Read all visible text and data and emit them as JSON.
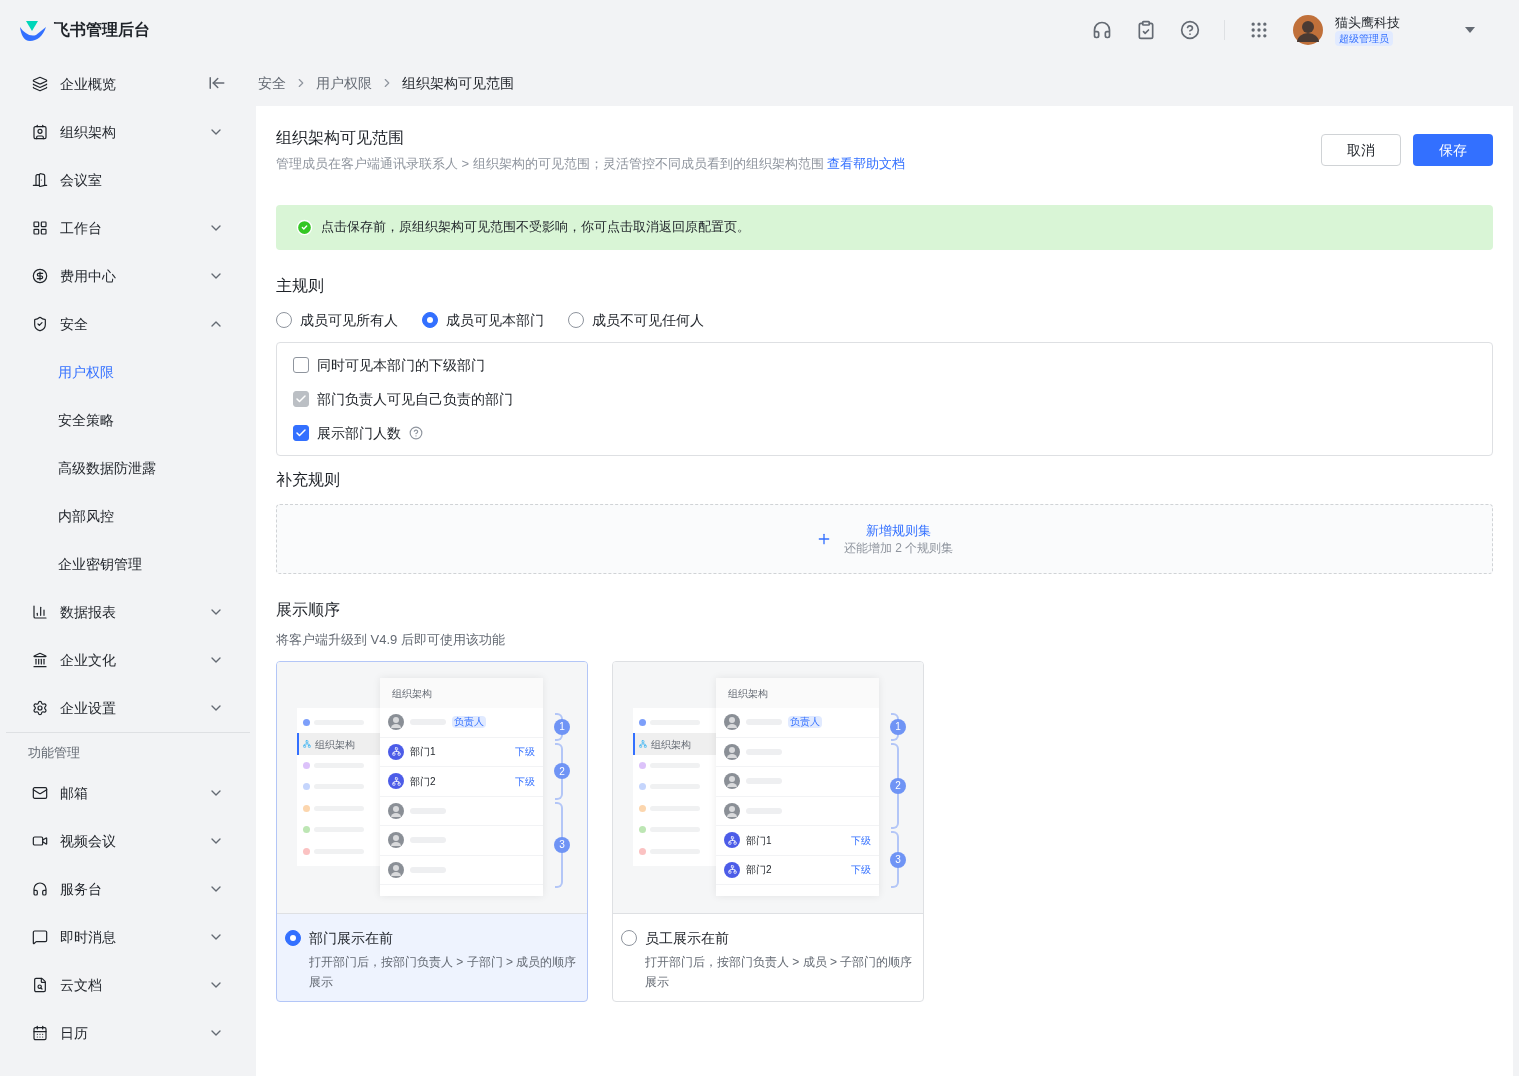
{
  "brand": {
    "name": "飞书管理后台"
  },
  "header": {
    "user": {
      "name": "猫头鹰科技",
      "role": "超级管理员"
    }
  },
  "sidebar": {
    "items": [
      {
        "label": "企业概览",
        "selected": false
      },
      {
        "label": "组织架构",
        "selected": false,
        "expanded": false
      },
      {
        "label": "会议室",
        "selected": false
      },
      {
        "label": "工作台",
        "selected": false,
        "expanded": false
      },
      {
        "label": "费用中心",
        "selected": false,
        "expanded": false
      },
      {
        "label": "安全",
        "selected": false,
        "expanded": true,
        "children": [
          {
            "label": "用户权限",
            "selected": true
          },
          {
            "label": "安全策略",
            "selected": false
          },
          {
            "label": "高级数据防泄露",
            "selected": false
          },
          {
            "label": "内部风控",
            "selected": false
          },
          {
            "label": "企业密钥管理",
            "selected": false
          }
        ]
      },
      {
        "label": "数据报表",
        "selected": false,
        "expanded": false
      },
      {
        "label": "企业文化",
        "selected": false,
        "expanded": false
      },
      {
        "label": "企业设置",
        "selected": false,
        "expanded": false
      }
    ],
    "section_title": "功能管理",
    "feature_items": [
      {
        "label": "邮箱",
        "selected": false,
        "expanded": false
      },
      {
        "label": "视频会议",
        "selected": false,
        "expanded": false
      },
      {
        "label": "服务台",
        "selected": false,
        "expanded": false
      },
      {
        "label": "即时消息",
        "selected": false,
        "expanded": false
      },
      {
        "label": "云文档",
        "selected": false,
        "expanded": false
      },
      {
        "label": "日历",
        "selected": false,
        "expanded": false
      }
    ]
  },
  "breadcrumb": [
    "安全",
    "用户权限",
    "组织架构可见范围"
  ],
  "page": {
    "title": "组织架构可见范围",
    "description": "管理成员在客户端通讯录联系人 > 组织架构的可见范围；灵活管控不同成员看到的组织架构范围",
    "help_link": "查看帮助文档",
    "buttons": [
      {
        "label": "取消",
        "kind": "secondary"
      },
      {
        "label": "保存",
        "kind": "primary"
      }
    ],
    "alert": "点击保存前，原组织架构可见范围不受影响，你可点击取消返回原配置页。"
  },
  "main_rule": {
    "title": "主规则",
    "options": [
      {
        "label": "成员可见所有人",
        "selected": false
      },
      {
        "label": "成员可见本部门",
        "selected": true
      },
      {
        "label": "成员不可见任何人",
        "selected": false
      }
    ],
    "checkboxes": [
      {
        "label": "同时可见本部门的下级部门",
        "checked": false,
        "disabled": false
      },
      {
        "label": "部门负责人可见自己负责的部门",
        "checked": true,
        "disabled": true
      },
      {
        "label": "展示部门人数",
        "checked": true,
        "disabled": false,
        "help": true
      }
    ]
  },
  "supplementary": {
    "title": "补充规则",
    "add_label": "新增规则集",
    "hint": "还能增加 2 个规则集"
  },
  "display_order": {
    "title": "展示顺序",
    "note": "将客户端升级到 V4.9 后即可使用该功能",
    "options": [
      {
        "label": "部门展示在前",
        "description": "打开部门后，按部门负责人 > 子部门 > 成员的顺序展示",
        "selected": true,
        "preview": {
          "header": "组织架构",
          "menu": [
            {
              "color": "#7d9ffa"
            },
            {
              "label": "组织架构",
              "selected": true
            },
            {
              "color": "#dcc2fa"
            },
            {
              "color": "#c5d5fc"
            },
            {
              "color": "#fcd6ae"
            },
            {
              "color": "#bde6b4"
            },
            {
              "color": "#fbc2c2"
            }
          ],
          "groups": [
            {
              "label": "1",
              "rows": [
                {
                  "kind": "person",
                  "tag": "负责人"
                }
              ]
            },
            {
              "label": "2",
              "rows": [
                {
                  "kind": "dept",
                  "label": "部门1",
                  "action": "下级"
                },
                {
                  "kind": "dept",
                  "label": "部门2",
                  "action": "下级"
                }
              ]
            },
            {
              "label": "3",
              "rows": [
                {
                  "kind": "person"
                },
                {
                  "kind": "person"
                },
                {
                  "kind": "person"
                }
              ]
            }
          ]
        }
      },
      {
        "label": "员工展示在前",
        "description": "打开部门后，按部门负责人 > 成员 > 子部门的顺序展示",
        "selected": false,
        "preview": {
          "header": "组织架构",
          "menu": [
            {
              "color": "#7d9ffa"
            },
            {
              "label": "组织架构",
              "selected": true
            },
            {
              "color": "#dcc2fa"
            },
            {
              "color": "#c5d5fc"
            },
            {
              "color": "#fcd6ae"
            },
            {
              "color": "#bde6b4"
            },
            {
              "color": "#fbc2c2"
            }
          ],
          "groups": [
            {
              "label": "1",
              "rows": [
                {
                  "kind": "person",
                  "tag": "负责人"
                }
              ]
            },
            {
              "label": "2",
              "rows": [
                {
                  "kind": "person"
                },
                {
                  "kind": "person"
                },
                {
                  "kind": "person"
                }
              ]
            },
            {
              "label": "3",
              "rows": [
                {
                  "kind": "dept",
                  "label": "部门1",
                  "action": "下级"
                },
                {
                  "kind": "dept",
                  "label": "部门2",
                  "action": "下级"
                }
              ]
            }
          ]
        }
      }
    ]
  }
}
